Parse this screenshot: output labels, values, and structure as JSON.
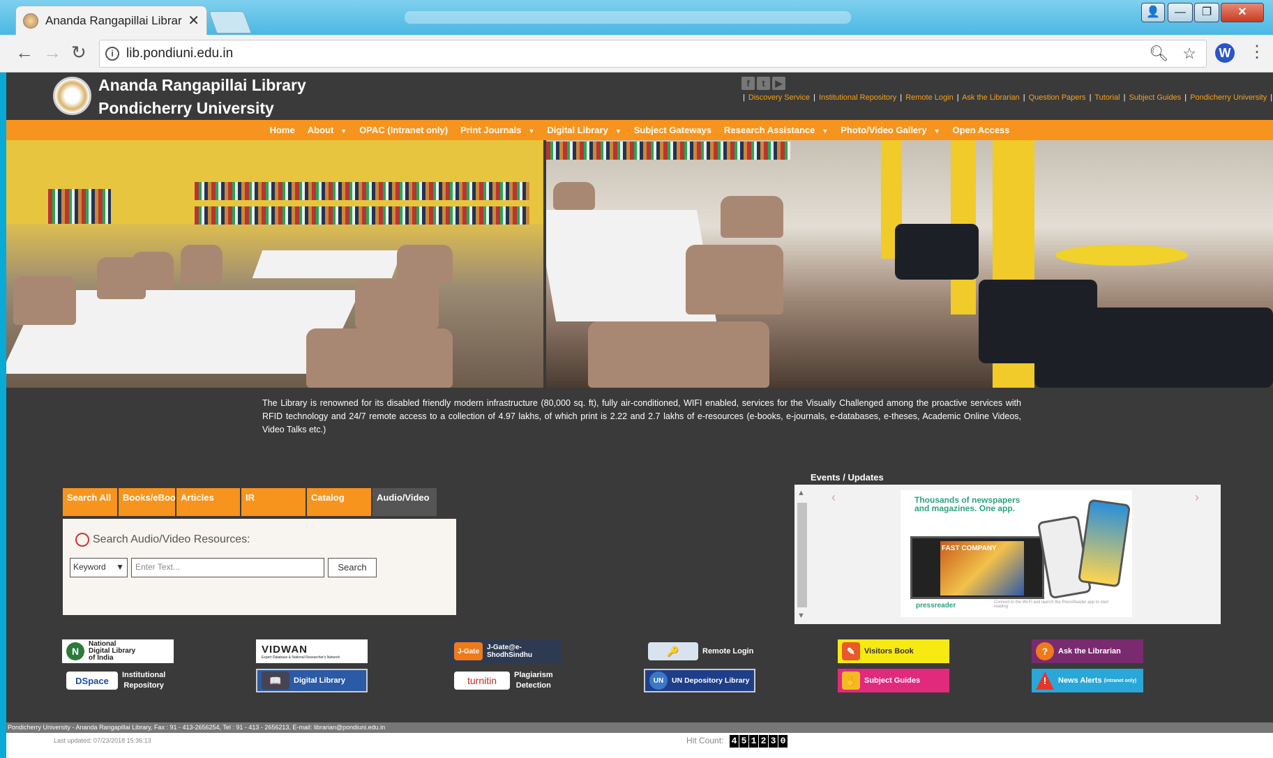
{
  "browser": {
    "tab_title": "Ananda Rangapillai Librar",
    "tab_close": "✕",
    "url": "lib.pondiuni.edu.in",
    "window_buttons": [
      "👤",
      "—",
      "❐",
      "✕"
    ],
    "ext_label": "W"
  },
  "site": {
    "title_line1": "Ananda Rangapillai Library",
    "title_line2": "Pondicherry University",
    "social": [
      "f",
      "t",
      "▶"
    ],
    "top_links": [
      "Discovery Service",
      "Institutional Repository",
      "Remote Login",
      "Ask the Librarian",
      "Question Papers",
      "Tutorial",
      "Subject Guides",
      "Pondicherry University"
    ],
    "separator": "|"
  },
  "nav": {
    "items": [
      "Home",
      "About",
      "OPAC (Intranet only)",
      "Print Journals",
      "Digital Library",
      "Subject Gateways",
      "Research Assistance",
      "Photo/Video Gallery",
      "Open Access"
    ],
    "caret": "▼"
  },
  "intro": "The Library is renowned for its disabled friendly modern infrastructure (80,000 sq. ft), fully air-conditioned, WIFI enabled, services for the Visually Challenged among the proactive services with RFID technology and 24/7 remote access to a collection of 4.97 lakhs, of which print is 2.22 and 2.7 lakhs of e-resources (e-books, e-journals, e-databases, e-theses, Academic Online Videos, Video Talks etc.)",
  "search": {
    "tabs": [
      "Search All",
      "Books/eBooks",
      "Articles",
      "IR",
      "Catalog",
      "Audio/Video"
    ],
    "active_tab": "Audio/Video",
    "heading": "Search Audio/Video Resources:",
    "select_value": "Keyword",
    "input_placeholder": "Enter Text...",
    "button": "Search"
  },
  "events": {
    "title": "Events / Updates",
    "headline": "Thousands of newspapers and magazines. One app.",
    "brand": "pressreader",
    "cover_text": "FAST COMPANY",
    "footnote": "Connect to the Wi-Fi and launch the PressReader app to start reading"
  },
  "links": [
    {
      "label_line1": "National",
      "label_line2": "Digital Library",
      "label_line3": "of India",
      "icon": "N"
    },
    {
      "label": "VIDWAN",
      "sub": "Expert Database & National Researcher's Network",
      "icon": "V"
    },
    {
      "label": "J-Gate@e-ShodhSindhu",
      "icon": "J-Gate"
    },
    {
      "label": "Remote Login",
      "icon": "🔑"
    },
    {
      "label": "Visitors Book",
      "icon": "✎"
    },
    {
      "label": "Ask the Librarian",
      "icon": "?"
    },
    {
      "label_line1": "Institutional",
      "label_line2": "Repository",
      "icon": "DSpace"
    },
    {
      "label": "Digital Library",
      "icon": "📖"
    },
    {
      "label_line1": "Plagiarism",
      "label_line2": "Detection",
      "icon": "turnitin"
    },
    {
      "label": "UN Depository Library",
      "icon": "UN"
    },
    {
      "label": "Subject Guides",
      "icon": "✋"
    },
    {
      "label": "News Alerts",
      "sub": "(intranet only)",
      "icon": "!"
    }
  ],
  "footer": {
    "address": "Pondicherry University - Ananda Rangapillai Library, Fax : 91 - 413-2656254, Tel : 91 - 413 - 2656213, E-mail: librarian@pondiuni.edu.in",
    "last_updated": "Last updated: 07/23/2018 15:36:13",
    "hit_label": "Hit Count:",
    "hit_digits": [
      "4",
      "5",
      "1",
      "2",
      "3",
      "0"
    ]
  },
  "colors": {
    "accent_orange": "#f7941d",
    "page_bg": "#3a3a3a",
    "link_orange": "#f7a21b"
  }
}
